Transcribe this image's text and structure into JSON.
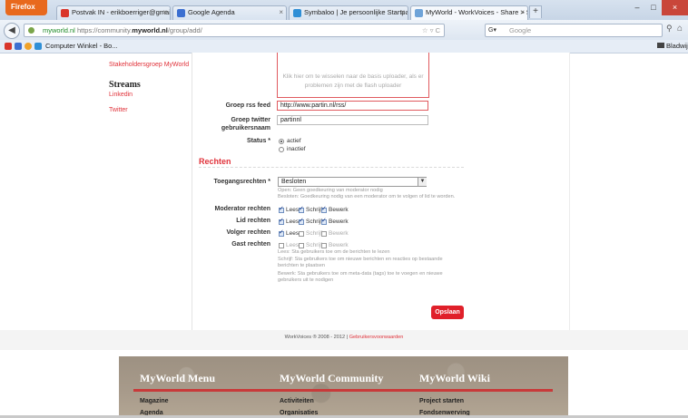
{
  "browser": {
    "menu_button": "Firefox",
    "tabs": [
      {
        "title": "Postvak IN - erikboerriger@gmail.co...",
        "icon_color": "#d9352b"
      },
      {
        "title": "Google Agenda",
        "icon_color": "#3b6fd1"
      },
      {
        "title": "Symbaloo | Je persoonlijke Startpagina",
        "icon_color": "#2f8fd6"
      },
      {
        "title": "MyWorld - WorkVoices - Share > Sear...",
        "icon_color": "#6ea3d8"
      }
    ],
    "new_tab": "+",
    "url_host": "myworld.nl",
    "url_prefix": "https://community.",
    "url_rest": "/group/add/",
    "search_placeholder": "Google",
    "bookmarks": [
      "Computer Winkel - Bo..."
    ],
    "bookmarks_folder": "Bladwijzers"
  },
  "sidebar": {
    "links_top": [
      "Stakeholdersgroep MyWorld"
    ],
    "streams_heading": "Streams",
    "stream_links": [
      "Linkedin",
      "Twitter"
    ]
  },
  "uploader": {
    "message": "Klik hier om te wisselen naar de basis uploader, als er problemen zijn met de flash uploader"
  },
  "form": {
    "rss_label": "Groep rss feed",
    "rss_value": "http://www.partin.nl/rss/",
    "twitter_label": "Groep twitter gebruikersnaam",
    "twitter_value": "partinnl",
    "status_label": "Status *",
    "status_options": [
      "actief",
      "inactief"
    ],
    "status_selected": "actief"
  },
  "rights": {
    "section_title": "Rechten",
    "access_label": "Toegangsrechten *",
    "access_value": "Besloten",
    "access_help": [
      "Open: Geen goedkeuring van moderator nodig",
      "Besloten: Goedkeuring nodig van een moderator om te volgen of lid te worden."
    ],
    "perm_labels": [
      "Lees",
      "Schrijf",
      "Bewerk"
    ],
    "rows": [
      {
        "label": "Moderator rechten",
        "checked": [
          true,
          true,
          true
        ]
      },
      {
        "label": "Lid rechten",
        "checked": [
          true,
          true,
          true
        ]
      },
      {
        "label": "Volger rechten",
        "checked": [
          true,
          false,
          false
        ]
      },
      {
        "label": "Gast rechten",
        "checked": [
          false,
          false,
          false
        ]
      }
    ],
    "perm_help": [
      "Lees: Sta gebruikers toe om de berichten te lezen",
      "Schrijf: Sta gebruikers toe om nieuwe berichten en reacties op bestaande",
      "berichten te plaatsen",
      "Bewerk: Sta gebruikers toe om meta-data (tags) toe te voegen en nieuwe",
      "gebruikers uit te nodigen"
    ],
    "save_label": "Opslaan"
  },
  "footer": {
    "copyright": "WorkVoices ® 2008 - 2012 |",
    "terms_link": "Gebruikersvoorwaarden",
    "columns": [
      {
        "title": "MyWorld Menu",
        "links": [
          "Magazine",
          "Agenda"
        ]
      },
      {
        "title": "MyWorld Community",
        "links": [
          "Activiteiten",
          "Organisaties"
        ]
      },
      {
        "title": "MyWorld Wiki",
        "links": [
          "Project starten",
          "Fondsenwerving"
        ]
      }
    ]
  },
  "colors": {
    "accent": "#e0323a",
    "save_button": "#e0202a",
    "firefox_orange": "#e8691d"
  }
}
